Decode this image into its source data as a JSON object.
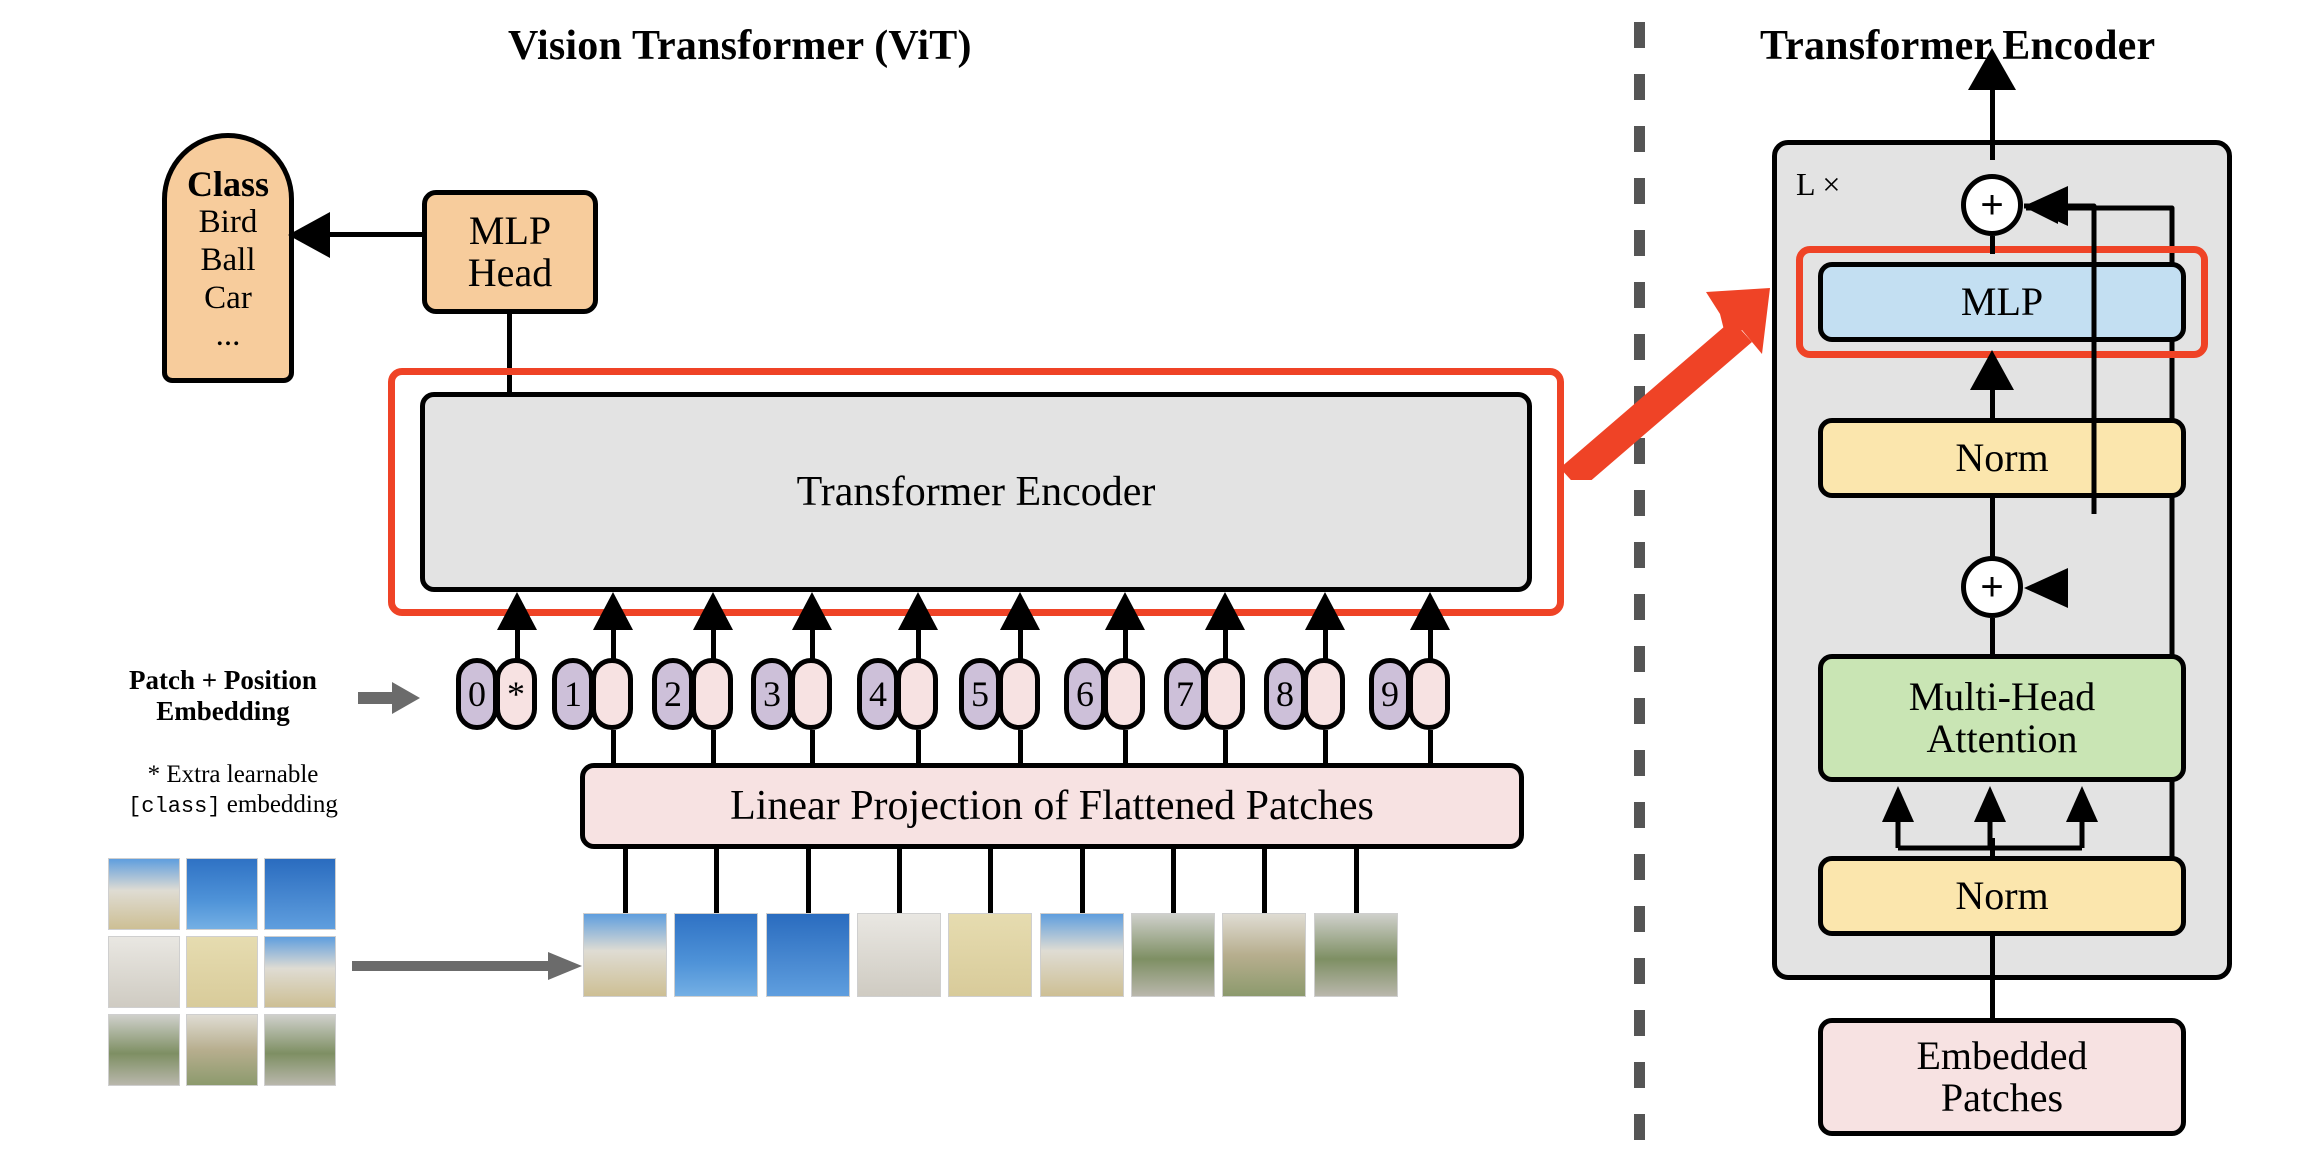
{
  "titles": {
    "left": "Vision Transformer (ViT)",
    "right": "Transformer Encoder"
  },
  "class_box": {
    "heading": "Class",
    "items": [
      "Bird",
      "Ball",
      "Car",
      "..."
    ]
  },
  "mlp_head": {
    "line1": "MLP",
    "line2": "Head"
  },
  "encoder_block": {
    "label": "Transformer Encoder"
  },
  "linear_projection": {
    "label": "Linear Projection of Flattened Patches"
  },
  "embedding_labels": {
    "title_line1": "Patch + Position",
    "title_line2": "Embedding",
    "note_line1": "* Extra learnable",
    "note_line2_code": "[class]",
    "note_line2_rest": " embedding"
  },
  "tokens": [
    {
      "number": "0",
      "extra": "*"
    },
    {
      "number": "1",
      "extra": ""
    },
    {
      "number": "2",
      "extra": ""
    },
    {
      "number": "3",
      "extra": ""
    },
    {
      "number": "4",
      "extra": ""
    },
    {
      "number": "5",
      "extra": ""
    },
    {
      "number": "6",
      "extra": ""
    },
    {
      "number": "7",
      "extra": ""
    },
    {
      "number": "8",
      "extra": ""
    },
    {
      "number": "9",
      "extra": ""
    }
  ],
  "encoder_detail": {
    "repeat_label": "L ×",
    "plus_symbol": "+",
    "mlp": "MLP",
    "norm_top": "Norm",
    "attention_line1": "Multi-Head",
    "attention_line2": "Attention",
    "norm_bottom": "Norm",
    "embedded_patches_line1": "Embedded",
    "embedded_patches_line2": "Patches"
  },
  "colors": {
    "orange": "#f7cc9c",
    "grey_panel": "#e3e3e3",
    "pink": "#f7e2e2",
    "yellow": "#fbe6ad",
    "green": "#c9e5b4",
    "blue": "#c3dff2",
    "purple_token": "#cdc0d9",
    "highlight_red": "#ef4326",
    "divider_grey": "#555555",
    "arrow_grey": "#6b6b6b"
  },
  "source_image_grid": {
    "rows": 3,
    "cols": 3,
    "tiles": [
      "dome-white-building-sky",
      "tower-clouds-sky",
      "tower-sky",
      "facade-windows-white",
      "yellow-palace-facade",
      "bell-tower-facade",
      "street-cars-hedge",
      "yellow-building-garden",
      "garden-path-trees"
    ]
  },
  "patch_sequence": {
    "count": 9,
    "tiles": [
      "dome-white-building-sky",
      "tower-clouds-sky",
      "tower-sky",
      "facade-windows-white",
      "yellow-palace-facade",
      "bell-tower-facade",
      "street-cars-hedge",
      "yellow-building-garden",
      "garden-path-trees"
    ]
  }
}
